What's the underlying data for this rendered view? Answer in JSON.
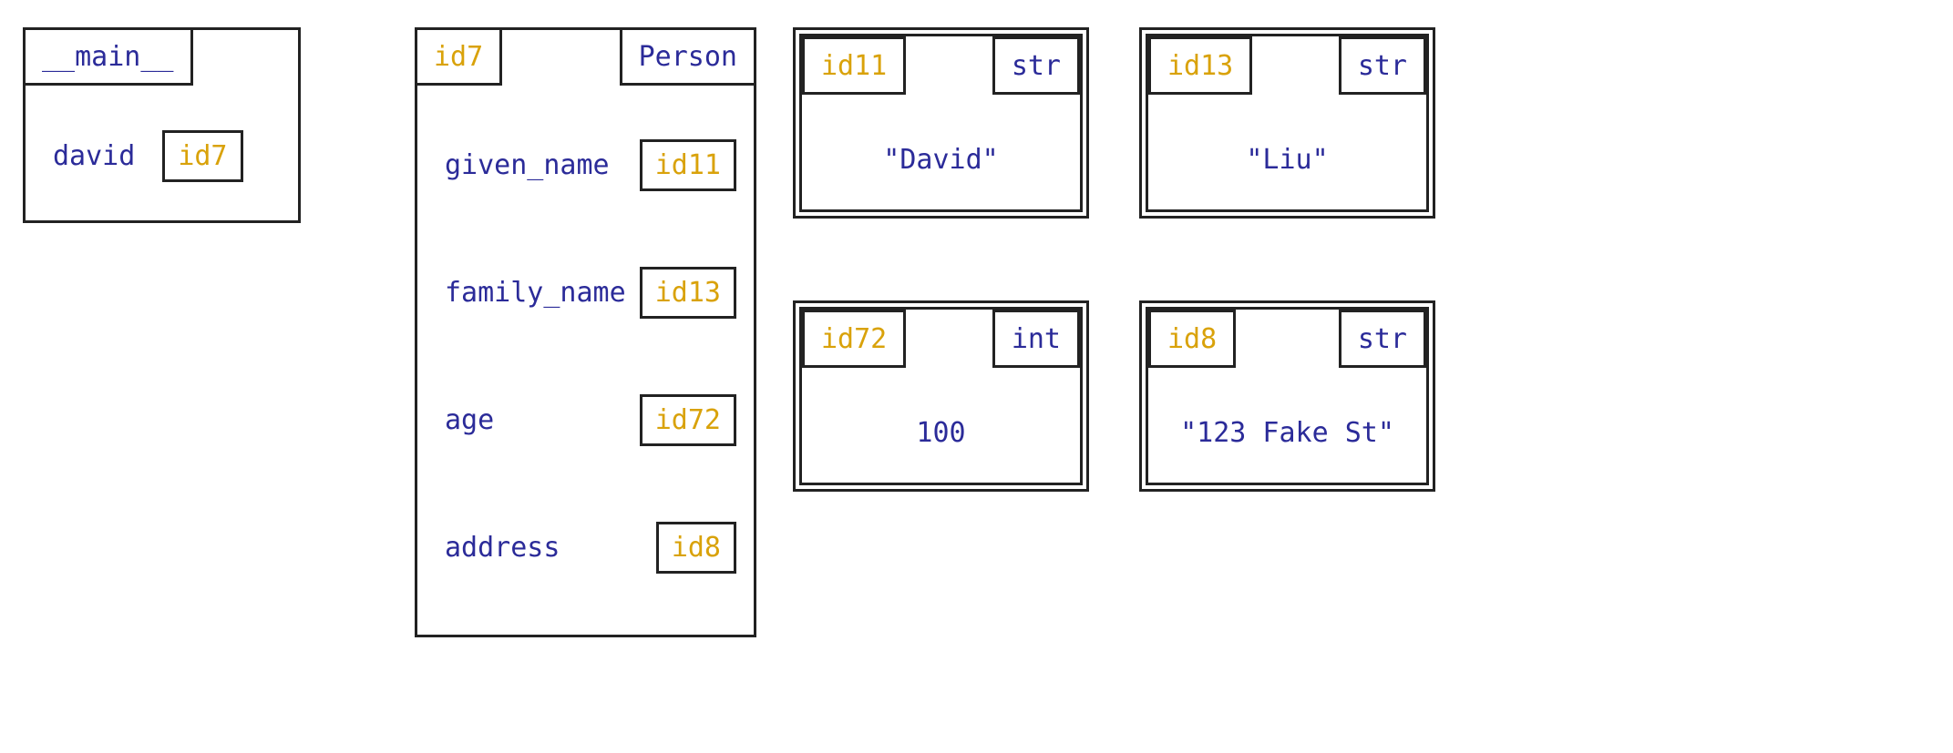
{
  "frame_main": {
    "title": "__main__",
    "var": "david",
    "ref": "id7"
  },
  "obj_person": {
    "id": "id7",
    "type": "Person",
    "attrs": [
      {
        "name": "given_name",
        "ref": "id11"
      },
      {
        "name": "family_name",
        "ref": "id13"
      },
      {
        "name": "age",
        "ref": "id72"
      },
      {
        "name": "address",
        "ref": "id8"
      }
    ]
  },
  "obj_given": {
    "id": "id11",
    "type": "str",
    "value": "\"David\""
  },
  "obj_family": {
    "id": "id13",
    "type": "str",
    "value": "\"Liu\""
  },
  "obj_age": {
    "id": "id72",
    "type": "int",
    "value": "100"
  },
  "obj_address": {
    "id": "id8",
    "type": "str",
    "value": "\"123 Fake St\""
  }
}
